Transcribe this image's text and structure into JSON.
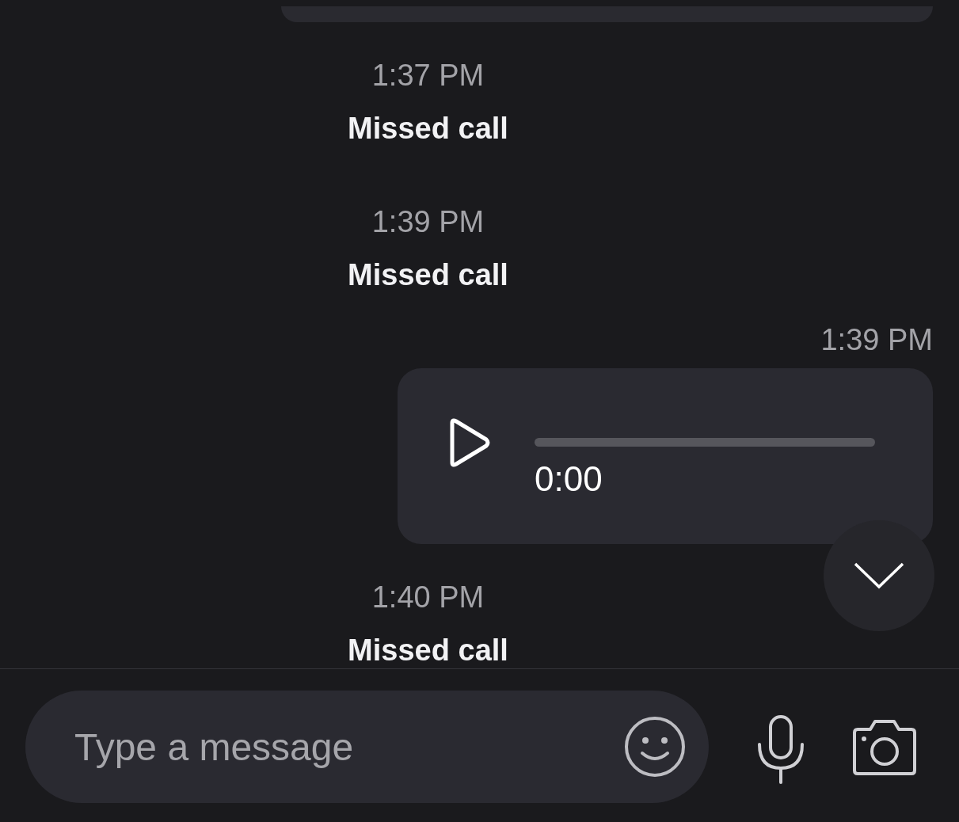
{
  "messages": [
    {
      "kind": "cut_bubble"
    },
    {
      "kind": "system",
      "time": "1:37 PM",
      "text": "Missed call"
    },
    {
      "kind": "system",
      "time": "1:39 PM",
      "text": "Missed call"
    },
    {
      "kind": "voice",
      "time": "1:39 PM",
      "duration": "0:00"
    },
    {
      "kind": "system",
      "time": "1:40 PM",
      "text": "Missed call"
    }
  ],
  "composer": {
    "placeholder": "Type a message"
  }
}
